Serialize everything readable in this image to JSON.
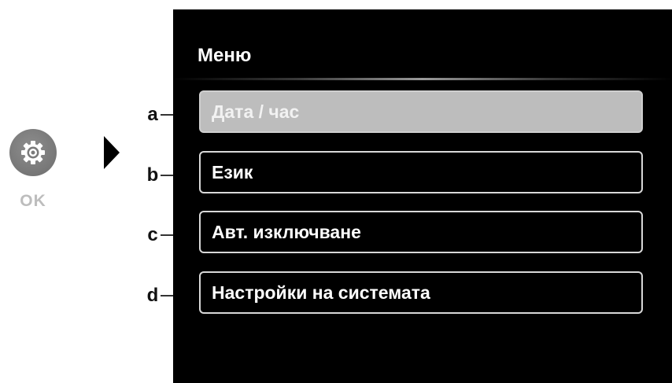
{
  "ok_button": {
    "icon": "gear-icon",
    "label": "OK"
  },
  "navigation": {
    "icon": "arrow-right-icon"
  },
  "menu": {
    "title": "Меню",
    "items": [
      {
        "label": "Дата / час",
        "callout": "a",
        "selected": true
      },
      {
        "label": "Език",
        "callout": "b",
        "selected": false
      },
      {
        "label": "Авт. изключване",
        "callout": "c",
        "selected": false
      },
      {
        "label": "Настройки на системата",
        "callout": "d",
        "selected": false
      }
    ]
  },
  "colors": {
    "screen_background": "#000000",
    "selected_item": "#bdbdbd",
    "item_border": "#d8d8d8",
    "ok_button": "#7a7a7a"
  }
}
